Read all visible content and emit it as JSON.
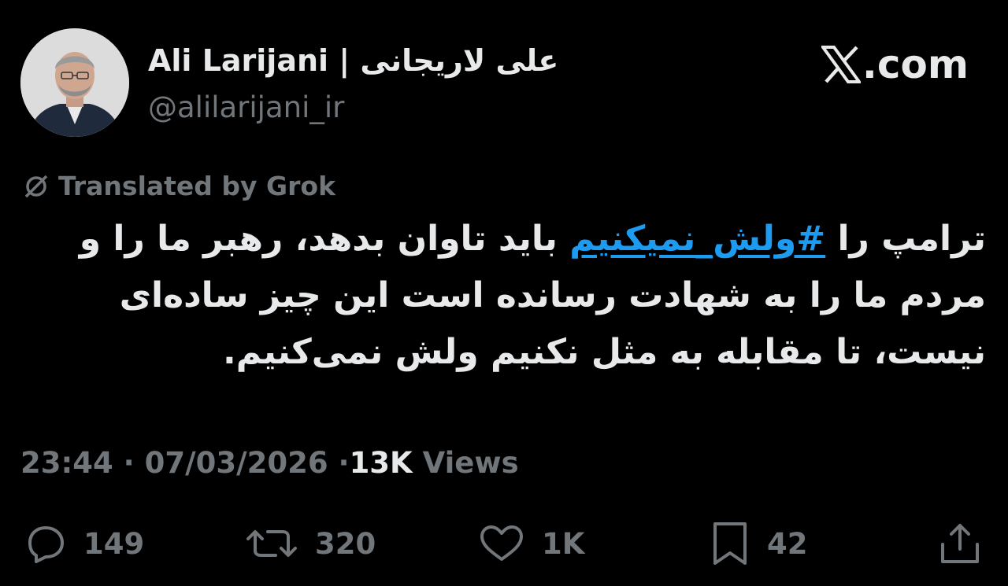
{
  "author": {
    "display_name": "Ali Larijani | علی لاریجانی",
    "handle": "@alilarijani_ir",
    "avatar": "profile-photo"
  },
  "brand": {
    "logo_icon": "x-logo-icon",
    "text": ".com"
  },
  "translation": {
    "icon": "grok-icon",
    "label": "Translated by Grok"
  },
  "tweet": {
    "text_before": "ترامپ را ",
    "hashtag": "#ولش_نمیکنیم",
    "text_after": " باید تاوان بدهد، رهبر ما را و مردم ما را به شهادت رسانده است این چیز ساده‌ای نیست، تا مقابله به مثل نکنیم ولش نمی‌کنیم."
  },
  "meta": {
    "time": "23:44",
    "separator": "·",
    "date": "07/03/2026",
    "views_count": "13K",
    "views_label": "Views"
  },
  "actions": {
    "reply": {
      "icon": "reply-icon",
      "count": "149"
    },
    "repost": {
      "icon": "repost-icon",
      "count": "320"
    },
    "like": {
      "icon": "heart-icon",
      "count": "1K"
    },
    "bookmark": {
      "icon": "bookmark-icon",
      "count": "42"
    },
    "share": {
      "icon": "share-icon"
    }
  },
  "colors": {
    "background": "#000000",
    "primary_text": "#e7e9ea",
    "secondary_text": "#71767b",
    "hashtag": "#1d9bf0"
  }
}
